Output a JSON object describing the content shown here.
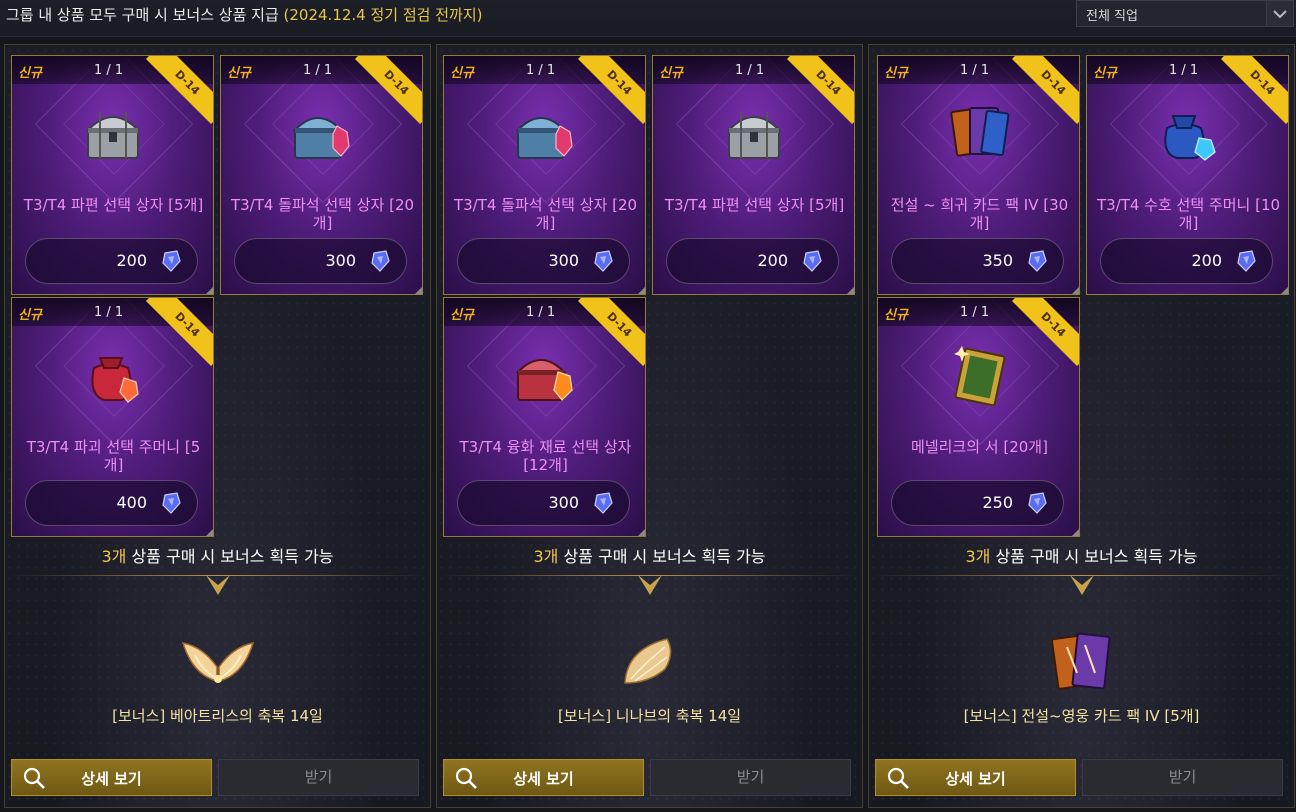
{
  "header": {
    "title": "그룹 내 상품 모두 구매 시 보너스 상품 지급",
    "period": "(2024.12.4 정기 점검 전까지)",
    "job_filter": "전체 직업"
  },
  "colors": {
    "accent_gold": "#f1c21a",
    "item_name": "#f08ff5",
    "bonus_name": "#f3e3a0",
    "card_purple": "#5a1f88"
  },
  "groups": [
    {
      "items": [
        {
          "badge": "신규",
          "count": "1 / 1",
          "ribbon": "D-14",
          "name": "T3/T4 파편 선택 상자 [5개]",
          "price": "200",
          "icon": "silver-chest-icon"
        },
        {
          "badge": "신규",
          "count": "1 / 1",
          "ribbon": "D-14",
          "name": "T3/T4 돌파석 선택 상자 [20개]",
          "price": "300",
          "icon": "blue-chest-icon"
        },
        {
          "badge": "신규",
          "count": "1 / 1",
          "ribbon": "D-14",
          "name": "T3/T4 파괴 선택 주머니 [5개]",
          "price": "400",
          "icon": "red-pouch-icon"
        }
      ],
      "bonus_count": "3개",
      "bonus_text": "상품 구매 시 보너스 획득 가능",
      "bonus_name": "[보너스] 베아트리스의 축복 14일",
      "bonus_icon": "wings-icon",
      "detail_label": "상세 보기",
      "receive_label": "받기"
    },
    {
      "items": [
        {
          "badge": "신규",
          "count": "1 / 1",
          "ribbon": "D-14",
          "name": "T3/T4 돌파석 선택 상자 [20개]",
          "price": "300",
          "icon": "blue-chest-icon"
        },
        {
          "badge": "신규",
          "count": "1 / 1",
          "ribbon": "D-14",
          "name": "T3/T4 파편 선택 상자 [5개]",
          "price": "200",
          "icon": "silver-chest-icon"
        },
        {
          "badge": "신규",
          "count": "1 / 1",
          "ribbon": "D-14",
          "name": "T3/T4 융화 재료 선택 상자 [12개]",
          "price": "300",
          "icon": "red-chest-icon"
        }
      ],
      "bonus_count": "3개",
      "bonus_text": "상품 구매 시 보너스 획득 가능",
      "bonus_name": "[보너스] 니나브의 축복 14일",
      "bonus_icon": "wing-icon",
      "detail_label": "상세 보기",
      "receive_label": "받기"
    },
    {
      "items": [
        {
          "badge": "신규",
          "count": "1 / 1",
          "ribbon": "D-14",
          "name": "전설 ~ 희귀 카드 팩 IV [30개]",
          "price": "350",
          "icon": "card-pack-icon"
        },
        {
          "badge": "신규",
          "count": "1 / 1",
          "ribbon": "D-14",
          "name": "T3/T4 수호 선택 주머니 [10개]",
          "price": "200",
          "icon": "blue-pouch-icon"
        },
        {
          "badge": "신규",
          "count": "1 / 1",
          "ribbon": "D-14",
          "name": "메넬리크의 서 [20개]",
          "price": "250",
          "icon": "book-icon"
        }
      ],
      "bonus_count": "3개",
      "bonus_text": "상품 구매 시 보너스 획득 가능",
      "bonus_name": "[보너스] 전설~영웅 카드 팩 IV [5개]",
      "bonus_icon": "card-pack-icon",
      "detail_label": "상세 보기",
      "receive_label": "받기"
    }
  ]
}
